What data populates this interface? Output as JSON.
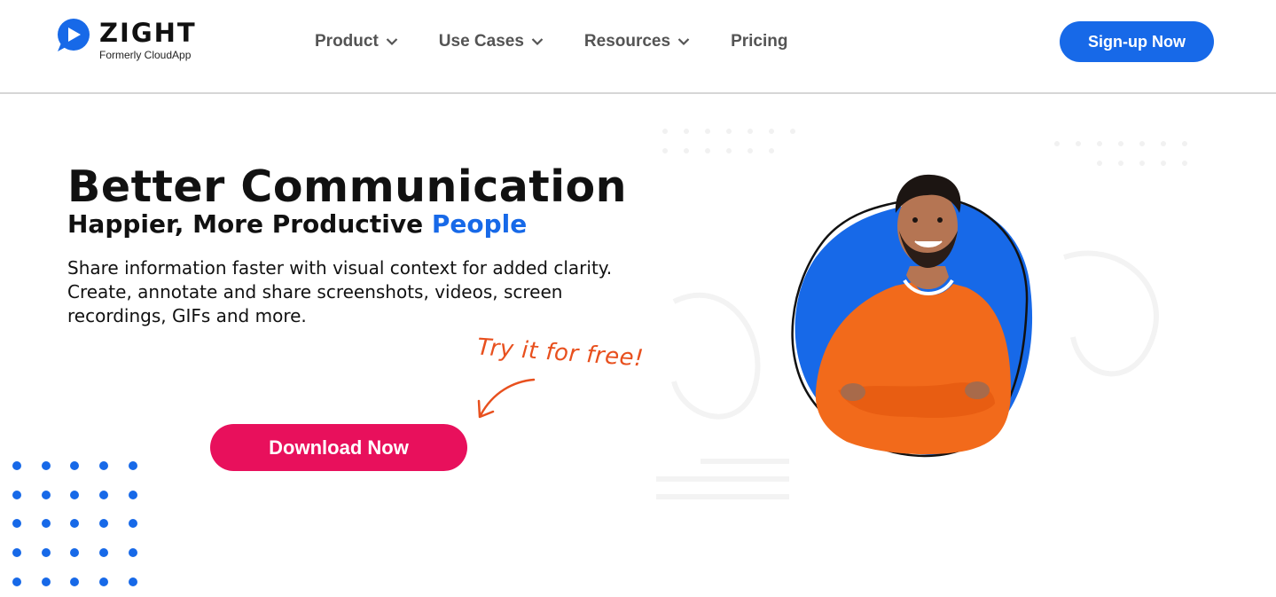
{
  "brand": {
    "name": "ZIGHT",
    "tagline": "Formerly CloudApp",
    "color": "#1769e8"
  },
  "nav": {
    "items": [
      {
        "label": "Product",
        "has_dropdown": true
      },
      {
        "label": "Use Cases",
        "has_dropdown": true
      },
      {
        "label": "Resources",
        "has_dropdown": true
      },
      {
        "label": "Pricing",
        "has_dropdown": false
      }
    ],
    "cta_label": "Sign-up Now"
  },
  "hero": {
    "title": "Better Communication",
    "subtitle_prefix": "Happier, More Productive ",
    "subtitle_accent": "People",
    "description": "Share information faster with visual context for added clarity. Create, annotate and share screenshots, videos, screen recordings, GIFs and more.",
    "try_note": "Try it for free!",
    "download_label": "Download Now"
  },
  "colors": {
    "primary_blue": "#1769e8",
    "download_pink": "#e8105c",
    "note_orange": "#e8501e",
    "sweater_orange": "#f26a1b"
  },
  "icons": {
    "logo": "zight-logo-icon",
    "chevron": "chevron-down-icon",
    "arrow": "hand-drawn-arrow-icon"
  }
}
